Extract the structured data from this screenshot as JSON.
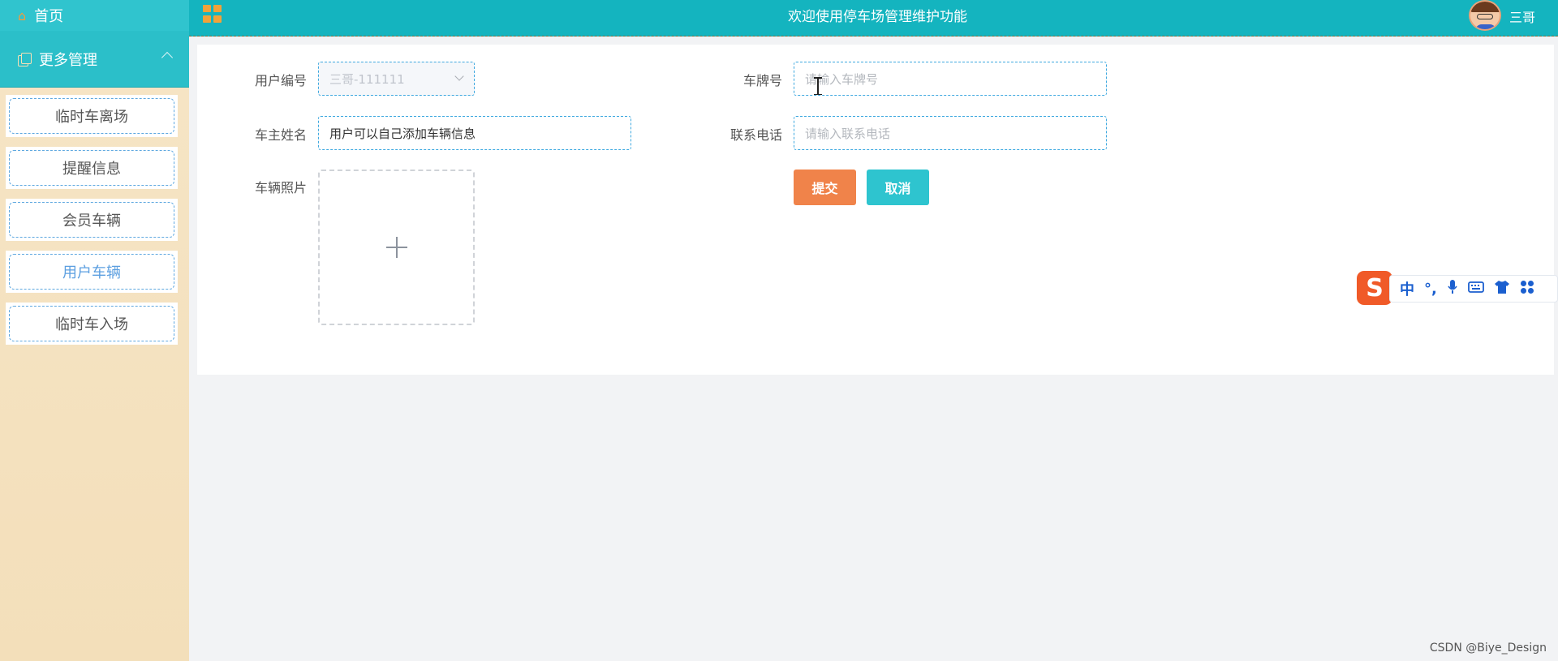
{
  "sidebar": {
    "home_label": "首页",
    "more_label": "更多管理",
    "items": [
      {
        "label": "临时车离场",
        "active": false
      },
      {
        "label": "提醒信息",
        "active": false
      },
      {
        "label": "会员车辆",
        "active": false
      },
      {
        "label": "用户车辆",
        "active": true
      },
      {
        "label": "临时车入场",
        "active": false
      }
    ]
  },
  "header": {
    "title": "欢迎使用停车场管理维护功能",
    "user_name": "三哥"
  },
  "form": {
    "user_id_label": "用户编号",
    "user_id_value": "三哥-111111",
    "plate_label": "车牌号",
    "plate_placeholder": "请输入车牌号",
    "owner_label": "车主姓名",
    "owner_value": "用户可以自己添加车辆信息",
    "phone_label": "联系电话",
    "phone_placeholder": "请输入联系电话",
    "photo_label": "车辆照片",
    "submit_label": "提交",
    "cancel_label": "取消"
  },
  "ime": {
    "logo": "S",
    "mode": "中",
    "punct": "°,"
  },
  "watermark": "CSDN @Biye_Design",
  "colors": {
    "header_bg": "#14b4bf",
    "sidebar_bg": "#f6e5c6",
    "submit": "#f0834a",
    "cancel": "#2ec4cf",
    "active_item": "#5c9fe0"
  }
}
